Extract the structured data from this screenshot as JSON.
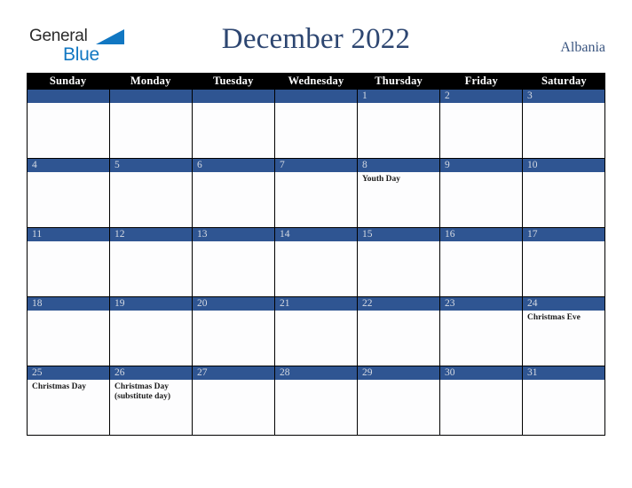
{
  "brand": {
    "name_top": "General",
    "name_bottom": "Blue",
    "triangle_icon": "blue-triangle-icon",
    "color_top": "#2b2b2b",
    "color_bottom": "#1177c2"
  },
  "header": {
    "title": "December 2022",
    "country": "Albania",
    "title_color": "#2d4671",
    "country_color": "#3a5580"
  },
  "calendar": {
    "weekday_headers": [
      "Sunday",
      "Monday",
      "Tuesday",
      "Wednesday",
      "Thursday",
      "Friday",
      "Saturday"
    ],
    "header_bg": "#000000",
    "header_text_color": "#ffffff",
    "day_bar_bg": "#2f5592",
    "day_bar_text_color": "#d5dae3",
    "cell_bg": "#fdfdfe",
    "grid_line_color": "#000000",
    "weeks": [
      [
        {
          "day": "",
          "events": []
        },
        {
          "day": "",
          "events": []
        },
        {
          "day": "",
          "events": []
        },
        {
          "day": "",
          "events": []
        },
        {
          "day": "1",
          "events": []
        },
        {
          "day": "2",
          "events": []
        },
        {
          "day": "3",
          "events": []
        }
      ],
      [
        {
          "day": "4",
          "events": []
        },
        {
          "day": "5",
          "events": []
        },
        {
          "day": "6",
          "events": []
        },
        {
          "day": "7",
          "events": []
        },
        {
          "day": "8",
          "events": [
            "Youth Day"
          ]
        },
        {
          "day": "9",
          "events": []
        },
        {
          "day": "10",
          "events": []
        }
      ],
      [
        {
          "day": "11",
          "events": []
        },
        {
          "day": "12",
          "events": []
        },
        {
          "day": "13",
          "events": []
        },
        {
          "day": "14",
          "events": []
        },
        {
          "day": "15",
          "events": []
        },
        {
          "day": "16",
          "events": []
        },
        {
          "day": "17",
          "events": []
        }
      ],
      [
        {
          "day": "18",
          "events": []
        },
        {
          "day": "19",
          "events": []
        },
        {
          "day": "20",
          "events": []
        },
        {
          "day": "21",
          "events": []
        },
        {
          "day": "22",
          "events": []
        },
        {
          "day": "23",
          "events": []
        },
        {
          "day": "24",
          "events": [
            "Christmas Eve"
          ]
        }
      ],
      [
        {
          "day": "25",
          "events": [
            "Christmas Day"
          ]
        },
        {
          "day": "26",
          "events": [
            "Christmas Day (substitute day)"
          ]
        },
        {
          "day": "27",
          "events": []
        },
        {
          "day": "28",
          "events": []
        },
        {
          "day": "29",
          "events": []
        },
        {
          "day": "30",
          "events": []
        },
        {
          "day": "31",
          "events": []
        }
      ]
    ]
  }
}
